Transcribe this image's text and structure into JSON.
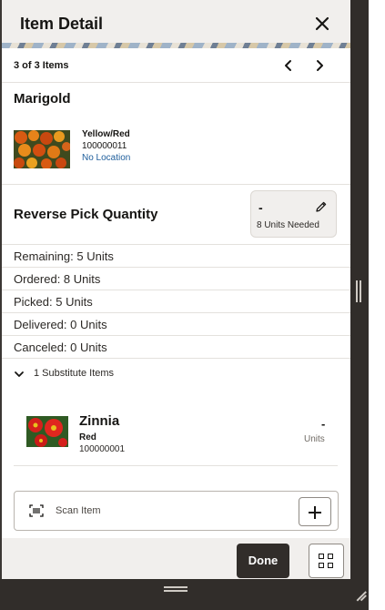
{
  "header": {
    "title": "Item Detail",
    "close_icon": "close-icon"
  },
  "navigation": {
    "count_label": "3 of 3 Items",
    "prev_icon": "chevron-left-icon",
    "next_icon": "chevron-right-icon"
  },
  "item": {
    "name": "Marigold",
    "color": "Yellow/Red",
    "sku": "100000011",
    "location": "No Location",
    "image_icon": "marigold-photo"
  },
  "reverse_pick": {
    "title": "Reverse Pick Quantity",
    "quantity": "-",
    "units_needed": "8 Units Needed",
    "edit_icon": "pencil-icon"
  },
  "stats": [
    {
      "label": "Remaining: 5 Units"
    },
    {
      "label": "Ordered: 8 Units"
    },
    {
      "label": "Picked: 5 Units"
    },
    {
      "label": "Delivered: 0 Units"
    },
    {
      "label": "Canceled: 0 Units"
    }
  ],
  "substitutes": {
    "toggle_label": "1 Substitute Items",
    "items": [
      {
        "name": "Zinnia",
        "color": "Red",
        "sku": "100000001",
        "quantity": "-",
        "units_label": "Units"
      }
    ]
  },
  "scan": {
    "label": "Scan Item",
    "scan_icon": "barcode-scan-icon",
    "add_icon": "plus-icon"
  },
  "footer": {
    "done_label": "Done",
    "grid_icon": "grid-icon"
  },
  "colors": {
    "header_bg": "#f1efed",
    "link": "#1e5e9c",
    "primary_button": "#312d2a",
    "frame": "#312d2a"
  }
}
